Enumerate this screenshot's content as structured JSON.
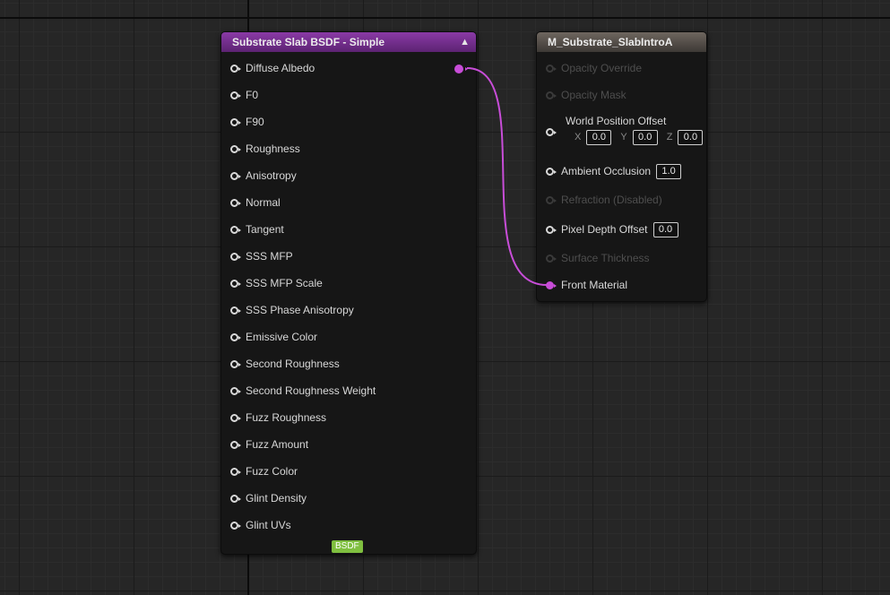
{
  "slab_node": {
    "title": "Substrate Slab BSDF - Simple",
    "output_label": "BSDF",
    "inputs": [
      "Diffuse Albedo",
      "F0",
      "F90",
      "Roughness",
      "Anisotropy",
      "Normal",
      "Tangent",
      "SSS MFP",
      "SSS MFP Scale",
      "SSS Phase Anisotropy",
      "Emissive Color",
      "Second Roughness",
      "Second Roughness Weight",
      "Fuzz Roughness",
      "Fuzz Amount",
      "Fuzz Color",
      "Glint Density",
      "Glint UVs"
    ]
  },
  "material_node": {
    "title": "M_Substrate_SlabIntroA",
    "opacity_override": "Opacity Override",
    "opacity_mask": "Opacity Mask",
    "world_position_offset": {
      "label": "World Position Offset",
      "x_label": "X",
      "x": "0.0",
      "y_label": "Y",
      "y": "0.0",
      "z_label": "Z",
      "z": "0.0"
    },
    "ambient_occlusion": {
      "label": "Ambient Occlusion",
      "value": "1.0"
    },
    "refraction": "Refraction (Disabled)",
    "pixel_depth_offset": {
      "label": "Pixel Depth Offset",
      "value": "0.0"
    },
    "surface_thickness": "Surface Thickness",
    "front_material": "Front Material"
  },
  "colors": {
    "wire": "#c84dd8",
    "slab_header": "#8a3aa6",
    "material_header": "#6e665f",
    "bsdf_badge": "#7fbf3f"
  }
}
